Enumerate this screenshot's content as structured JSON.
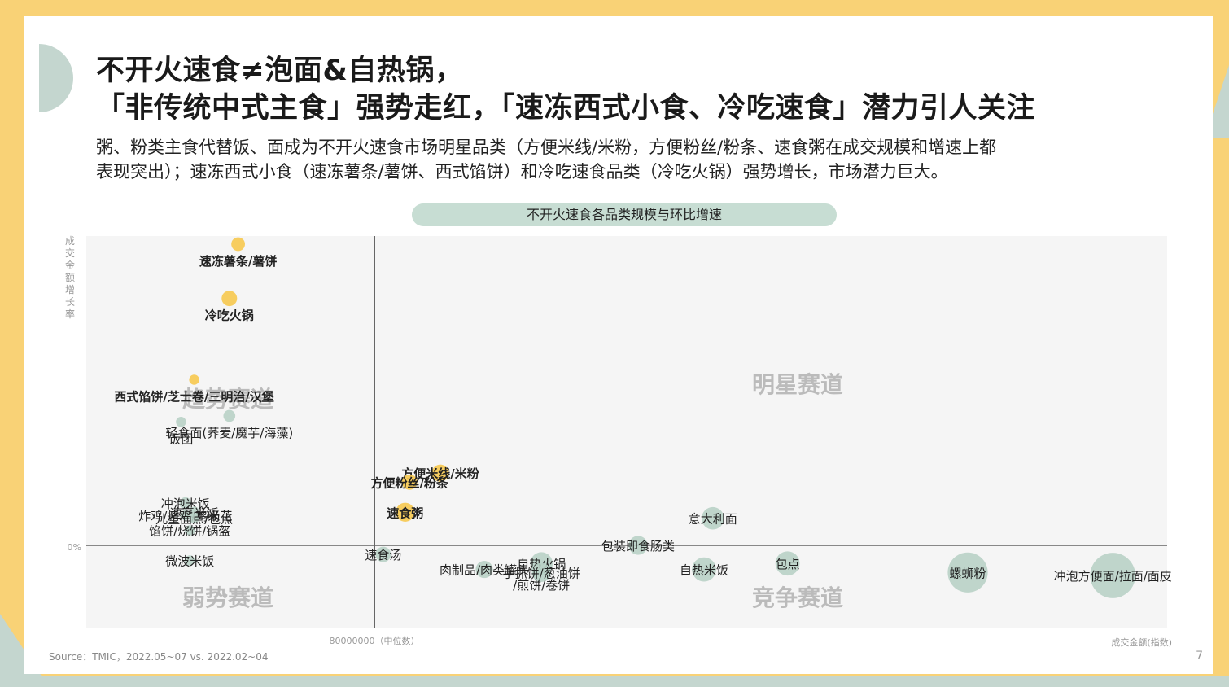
{
  "header": {
    "title_line1": "不开火速食≠泡面&自热锅，",
    "title_line2": "「非传统中式主食」强势走红，「速冻西式小食、冷吃速食」潜力引人关注",
    "subtitle_line1": "粥、粉类主食代替饭、面成为不开火速食市场明星品类（方便米线/米粉，方便粉丝/粉条、速食粥在成交规模和增速上都",
    "subtitle_line2": "表现突出）；速冻西式小食（速冻薯条/薯饼、西式馅饼）和冷吃速食品类（冷吃火锅）强势增长，市场潜力巨大。"
  },
  "footer": {
    "source": "Source：TMIC，2022.05~07 vs. 2022.02~04",
    "page_number": "7"
  },
  "colors": {
    "background": "#f9d276",
    "accent_green": "#c4d6cf",
    "bubble_yellow": "#f7c94f",
    "bubble_green": "#b9d2c7",
    "quadrant_label": "#bbbbbb"
  },
  "chart_data": {
    "type": "scatter",
    "title": "不开火速食各品类规模与环比增速",
    "ylabel": "成交金额增长率",
    "xlabel": "成交金额(指数)",
    "x_divider_label": "80000000（中位数）",
    "y_zero_label": "0%",
    "quadrants": [
      {
        "name": "明星赛道",
        "position": "top-right"
      },
      {
        "name": "趋势赛道",
        "position": "top-left"
      },
      {
        "name": "弱势赛道",
        "position": "bottom-left"
      },
      {
        "name": "竞争赛道",
        "position": "bottom-right"
      }
    ],
    "points": [
      {
        "label": "速冻薯条/薯饼",
        "x": -0.31,
        "y": 1.0,
        "size": 1.0,
        "color": "yellow",
        "bold": true
      },
      {
        "label": "冷吃火锅",
        "x": -0.33,
        "y": 0.82,
        "size": 1.2,
        "color": "yellow",
        "bold": true
      },
      {
        "label": "西式馅饼/芝士卷/三明治/汉堡",
        "x": -0.41,
        "y": 0.55,
        "size": 0.6,
        "color": "yellow",
        "bold": true
      },
      {
        "label": "饭团",
        "x": -0.44,
        "y": 0.41,
        "size": 0.6,
        "color": "green",
        "bold": false
      },
      {
        "label": "轻食面(荞麦/魔芋/海藻)",
        "x": -0.33,
        "y": 0.43,
        "size": 0.8,
        "color": "green",
        "bold": false
      },
      {
        "label": "方便米线/米粉",
        "x": 0.15,
        "y": 0.24,
        "size": 1.4,
        "color": "yellow",
        "bold": true
      },
      {
        "label": "方便粉丝/粉条",
        "x": 0.08,
        "y": 0.21,
        "size": 1.2,
        "color": "yellow",
        "bold": true
      },
      {
        "label": "冲泡米饭",
        "x": -0.43,
        "y": 0.14,
        "size": 0.8,
        "color": "green",
        "bold": false
      },
      {
        "label": "速烹米饭",
        "x": -0.41,
        "y": 0.11,
        "size": 0.7,
        "color": "green",
        "bold": false
      },
      {
        "label": "炸鸡/烤鸡/鸡米花",
        "x": -0.43,
        "y": 0.1,
        "size": 0.6,
        "color": "green",
        "bold": false
      },
      {
        "label": "儿童面点/包点",
        "x": -0.41,
        "y": 0.09,
        "size": 0.6,
        "color": "green",
        "bold": false
      },
      {
        "label": "速食粥",
        "x": 0.07,
        "y": 0.11,
        "size": 1.6,
        "color": "yellow",
        "bold": true
      },
      {
        "label": "馅饼/烧饼/锅盔",
        "x": -0.42,
        "y": 0.05,
        "size": 0.6,
        "color": "green",
        "bold": false
      },
      {
        "label": "意大利面",
        "x": 0.77,
        "y": 0.09,
        "size": 2.0,
        "color": "green",
        "bold": false
      },
      {
        "label": "包装即食肠类",
        "x": 0.6,
        "y": 0.0,
        "size": 1.6,
        "color": "green",
        "bold": false
      },
      {
        "label": "微波米饭",
        "x": -0.42,
        "y": -0.05,
        "size": 0.6,
        "color": "green",
        "bold": false
      },
      {
        "label": "速食汤",
        "x": 0.02,
        "y": -0.03,
        "size": 1.2,
        "color": "green",
        "bold": false
      },
      {
        "label": "自热火锅",
        "x": 0.38,
        "y": -0.06,
        "size": 2.0,
        "color": "green",
        "bold": false
      },
      {
        "label": "手抓饼/葱油饼",
        "x": 0.38,
        "y": -0.09,
        "size": 1.6,
        "color": "green",
        "bold": false
      },
      {
        "label": "/煎饼/卷饼",
        "x": 0.38,
        "y": -0.13,
        "size": 0.0,
        "color": "green",
        "bold": false
      },
      {
        "label": "肉制品/肉类罐头",
        "x": 0.25,
        "y": -0.08,
        "size": 1.4,
        "color": "green",
        "bold": false
      },
      {
        "label": "自热米饭",
        "x": 0.75,
        "y": -0.08,
        "size": 2.2,
        "color": "green",
        "bold": false
      },
      {
        "label": "包点",
        "x": 0.94,
        "y": -0.06,
        "size": 2.2,
        "color": "green",
        "bold": false
      },
      {
        "label": "螺蛳粉",
        "x": 1.35,
        "y": -0.09,
        "size": 4.0,
        "color": "green",
        "bold": false
      },
      {
        "label": "冲泡方便面/拉面/面皮",
        "x": 1.68,
        "y": -0.1,
        "size": 4.6,
        "color": "green",
        "bold": false
      }
    ]
  }
}
